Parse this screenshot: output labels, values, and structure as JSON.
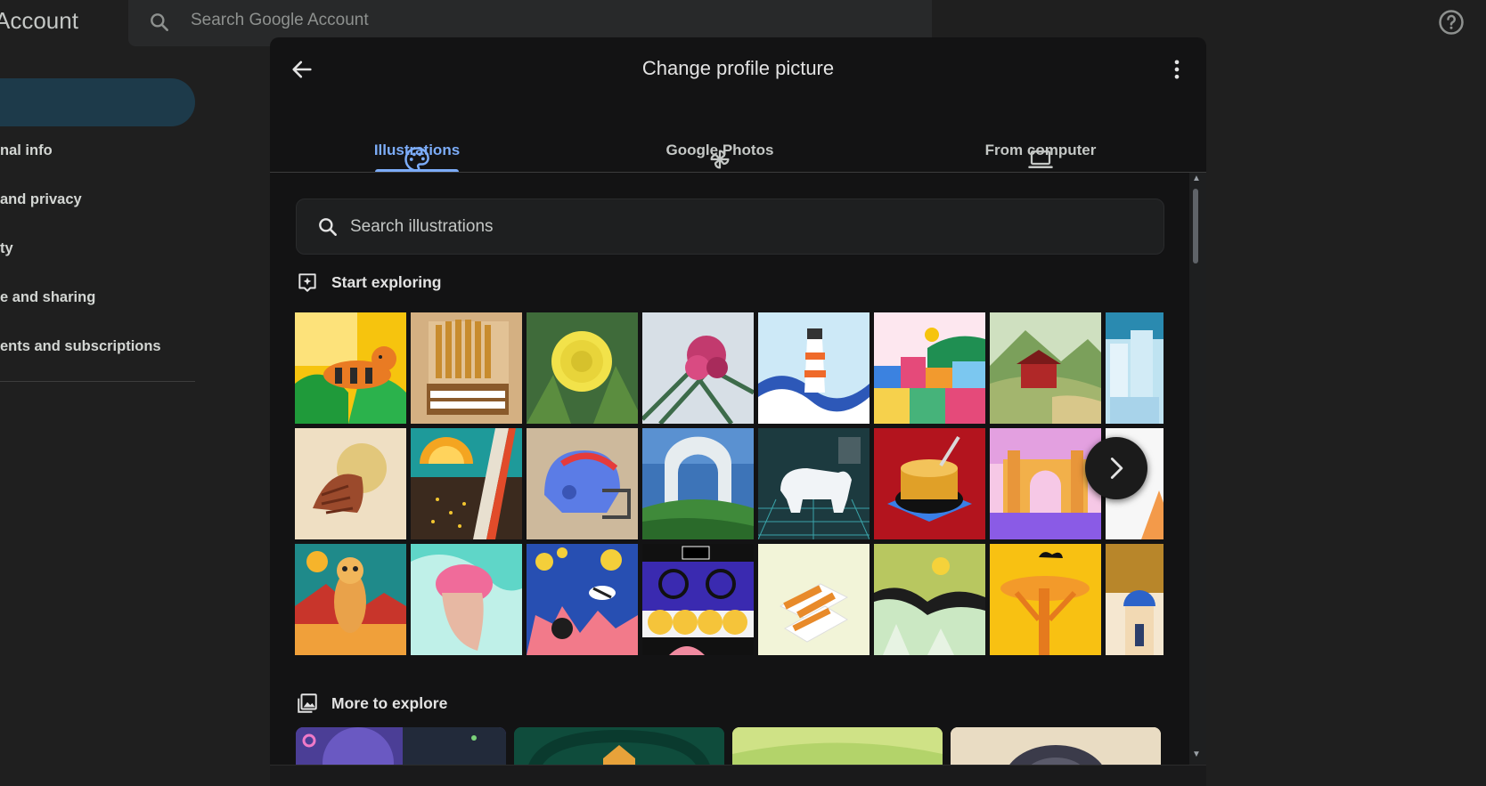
{
  "header": {
    "brand_fragment": "Account",
    "search_placeholder": "Search Google Account"
  },
  "sidebar": {
    "items": [
      {
        "label": "nal info"
      },
      {
        "label": "and privacy"
      },
      {
        "label": "ty"
      },
      {
        "label": "e and sharing"
      },
      {
        "label": "ents and subscriptions"
      }
    ]
  },
  "dialog": {
    "title": "Change profile picture",
    "tabs": [
      {
        "label": "Illustrations",
        "icon": "palette-icon",
        "active": true
      },
      {
        "label": "Google Photos",
        "icon": "pinwheel-icon",
        "active": false
      },
      {
        "label": "From computer",
        "icon": "laptop-icon",
        "active": false
      }
    ],
    "search_placeholder": "Search illustrations",
    "sections": {
      "start_exploring": "Start exploring",
      "more_to_explore": "More to explore"
    },
    "illustrations": [
      "cat-on-leaves",
      "pipe-organ",
      "chrysanthemum",
      "pink-flower-ferns",
      "lighthouse-waves",
      "colorful-houses",
      "red-barn-hills",
      "city-skyline",
      "hermit-crab",
      "citrus-grater",
      "football-helmet",
      "stone-bridge",
      "polar-bear-grid",
      "soup-bowl",
      "gateway-arch",
      "partial-tile",
      "meerkat",
      "swim-cap-swimmer",
      "coral-reef",
      "oven-bread",
      "sandals",
      "green-mountains",
      "yellow-trees",
      "blue-dome"
    ]
  },
  "colors": {
    "accent": "#7cacf8",
    "background": "#1f1f1f",
    "dialog": "#131314"
  }
}
